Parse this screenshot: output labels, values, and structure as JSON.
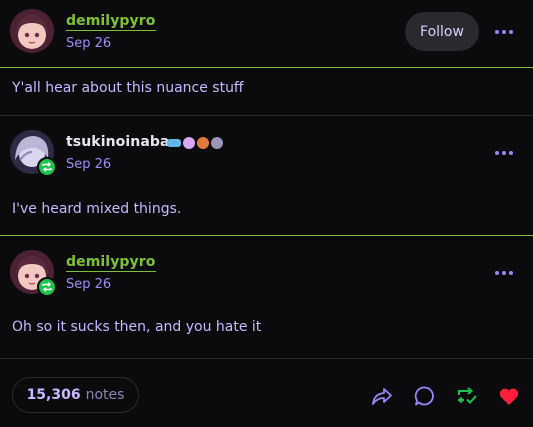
{
  "post": {
    "author": "demilypyro",
    "date": "Sep 26",
    "follow_label": "Follow",
    "text": "Y'all hear about this nuance stuff"
  },
  "reblogs": [
    {
      "author": "tsukinoinaba",
      "date": "Sep 26",
      "text": "I've heard mixed things."
    },
    {
      "author": "demilypyro",
      "date": "Sep 26",
      "text": "Oh so it sucks then, and you hate it"
    }
  ],
  "footer": {
    "notes_count": "15,306",
    "notes_label": "notes"
  },
  "colors": {
    "accent_green": "#7fc23a",
    "text_purple": "#c9b8ff",
    "like_red": "#ff1f3a",
    "reblog_green": "#1fc24a"
  },
  "icons": [
    "share-icon",
    "reply-icon",
    "reblog-icon",
    "like-icon",
    "more-icon"
  ]
}
